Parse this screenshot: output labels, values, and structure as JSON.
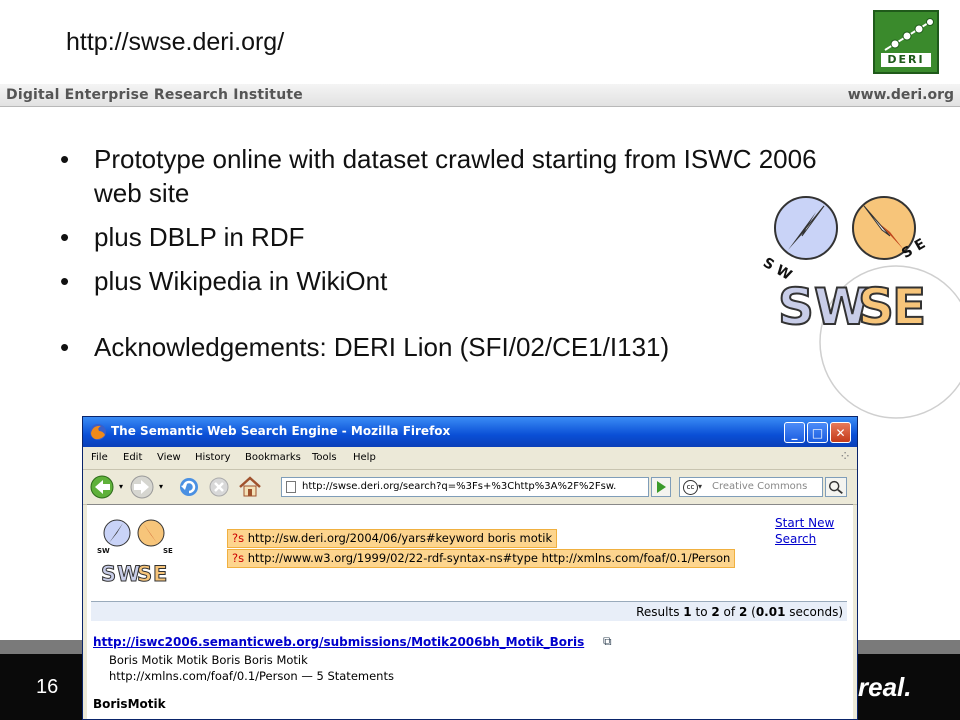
{
  "slide": {
    "title": "http://swse.deri.org/",
    "header_left": "Digital Enterprise Research Institute",
    "header_right": "www.deri.org",
    "deri_logo_text": "DERI",
    "page_number": "16",
    "footer_tag": "real.",
    "bullets": [
      "Prototype online with dataset crawled starting from ISWC 2006 web site",
      "plus DBLP in RDF",
      "plus Wikipedia in WikiOnt",
      "Acknowledgements: DERI Lion (SFI/02/CE1/I131)"
    ],
    "swse_logo": {
      "letters": "SWSE",
      "left_label": "SW",
      "right_label": "SE"
    }
  },
  "browser": {
    "window_title": "The Semantic Web Search Engine - Mozilla Firefox",
    "menu": [
      "File",
      "Edit",
      "View",
      "History",
      "Bookmarks",
      "Tools",
      "Help"
    ],
    "url": "http://swse.deri.org/search?q=%3Fs+%3Chttp%3A%2F%2Fsw.",
    "search_placeholder": "Creative Commons",
    "page": {
      "queries": [
        {
          "var": "?s",
          "text": "http://sw.deri.org/2004/06/yars#keyword boris motik"
        },
        {
          "var": "?s",
          "text": "http://www.w3.org/1999/02/22-rdf-syntax-ns#type http://xmlns.com/foaf/0.1/Person"
        }
      ],
      "start_new_search": [
        "Start New",
        "Search"
      ],
      "results_summary": {
        "prefix": "Results",
        "from": "1",
        "to_word": "to",
        "to": "2",
        "of_word": "of",
        "total": "2",
        "seconds": "0.01",
        "seconds_suffix": "seconds)"
      },
      "results": [
        {
          "link": "http://iswc2006.semanticweb.org/submissions/Motik2006bh_Motik_Boris",
          "names": "Boris Motik Motik Boris Boris Motik",
          "type_line": "http://xmlns.com/foaf/0.1/Person — 5 Statements"
        },
        {
          "title": "BorisMotik"
        }
      ]
    }
  },
  "colors": {
    "deri_green": "#3a8a2c",
    "swse_blue": "#c9d3f7",
    "swse_orange": "#f7c57a",
    "query_highlight": "#fdd58e",
    "xp_title_blue": "#0a4fd6"
  }
}
